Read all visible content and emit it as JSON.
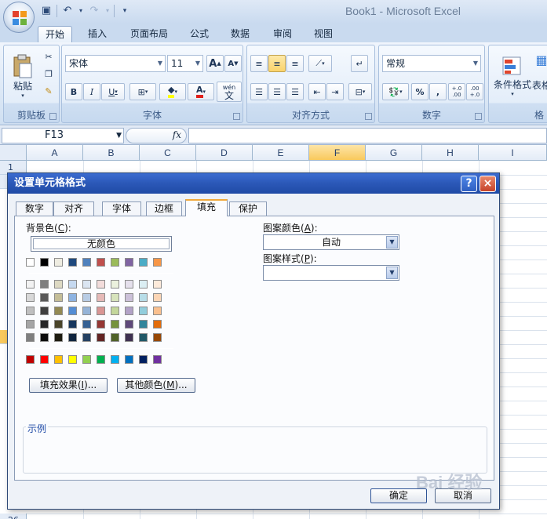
{
  "app": {
    "window_title": "Book1 - Microsoft Excel",
    "tabs": [
      "开始",
      "插入",
      "页面布局",
      "公式",
      "数据",
      "审阅",
      "视图"
    ],
    "active_tab": "开始"
  },
  "ribbon": {
    "clipboard": {
      "label": "剪贴板",
      "paste": "粘贴"
    },
    "font": {
      "label": "字体",
      "font_name": "宋体",
      "font_size": "11",
      "bold": "B",
      "italic": "I",
      "underline": "U",
      "grow": "A",
      "shrink": "A",
      "wen": "wén",
      "wen_char": "文"
    },
    "alignment": {
      "label": "对齐方式"
    },
    "number": {
      "label": "数字",
      "format": "常规",
      "percent": "%",
      "comma": ",",
      "inc_decimal": "+.0 .00",
      "dec_decimal": ".00 +.0"
    },
    "styles": {
      "conditional": "条件格式",
      "table_partial": "表格",
      "cell_partial": "格"
    }
  },
  "formula_bar": {
    "name_box": "F13",
    "fx": "fx"
  },
  "grid": {
    "columns": [
      "A",
      "B",
      "C",
      "D",
      "E",
      "F",
      "G",
      "H",
      "I"
    ],
    "selected_column": "F",
    "row_first": "1",
    "row_last": "26"
  },
  "dialog": {
    "title": "设置单元格格式",
    "help": "?",
    "close": "×",
    "tabs": [
      "数字",
      "对齐",
      "字体",
      "边框",
      "填充",
      "保护"
    ],
    "active_tab": "填充",
    "background_color_label": "背景色",
    "background_color_key": "C",
    "no_color": "无颜色",
    "fill_effects": "填充效果",
    "fill_effects_key": "I",
    "more_colors": "其他颜色",
    "more_colors_key": "M",
    "pattern_color_label": "图案颜色",
    "pattern_color_key": "A",
    "pattern_color_value": "自动",
    "pattern_style_label": "图案样式",
    "pattern_style_key": "P",
    "pattern_style_value": "",
    "sample_label": "示例",
    "ok": "确定",
    "cancel": "取消",
    "theme_row": [
      "#ffffff",
      "#000000",
      "#eeece1",
      "#1f497d",
      "#4f81bd",
      "#c0504d",
      "#9bbb59",
      "#8064a2",
      "#4bacc6",
      "#f79646"
    ],
    "tint_rows": [
      [
        "#f2f2f2",
        "#7f7f7f",
        "#ddd9c3",
        "#c6d9f0",
        "#dbe5f1",
        "#f2dcdb",
        "#ebf1dd",
        "#e5e0ec",
        "#dbeef3",
        "#fdeada"
      ],
      [
        "#d8d8d8",
        "#595959",
        "#c4bd97",
        "#8db3e2",
        "#b8cce4",
        "#e5b9b7",
        "#d7e3bc",
        "#ccc1d9",
        "#b7dde8",
        "#fbd5b5"
      ],
      [
        "#bfbfbf",
        "#3f3f3f",
        "#938953",
        "#548dd4",
        "#95b3d7",
        "#d99694",
        "#c3d69b",
        "#b2a2c7",
        "#92cddc",
        "#fac08f"
      ],
      [
        "#a5a5a5",
        "#262626",
        "#494429",
        "#17365d",
        "#366092",
        "#953734",
        "#76923c",
        "#5f497a",
        "#31859b",
        "#e36c09"
      ],
      [
        "#7f7f7f",
        "#0c0c0c",
        "#1d1b10",
        "#0f243e",
        "#244061",
        "#632423",
        "#4f6128",
        "#3f3151",
        "#205867",
        "#974806"
      ]
    ],
    "standard_row": [
      "#c00000",
      "#ff0000",
      "#ffc000",
      "#ffff00",
      "#92d050",
      "#00b050",
      "#00b0f0",
      "#0070c0",
      "#002060",
      "#7030a0"
    ]
  },
  "watermark": "Bai 经验"
}
